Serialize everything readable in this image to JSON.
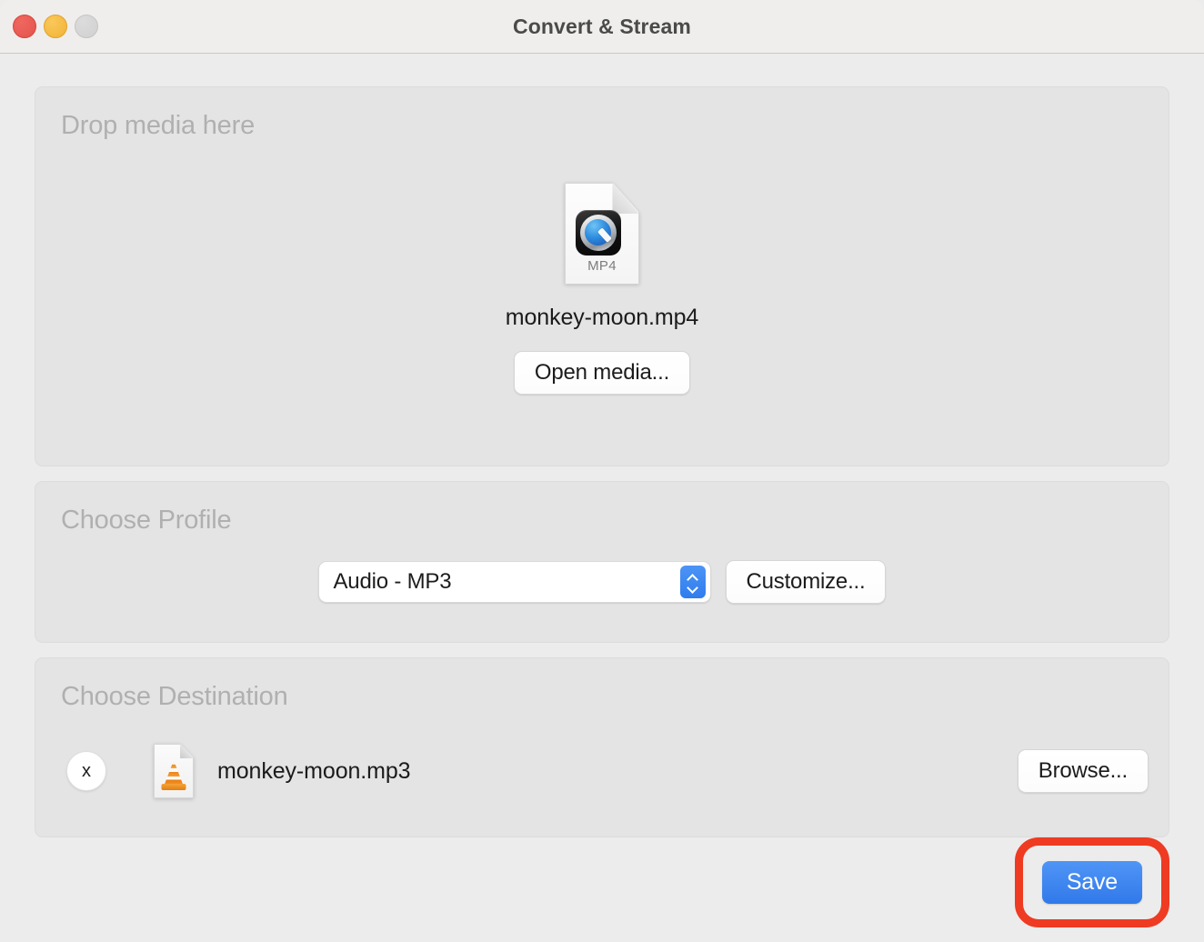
{
  "window": {
    "title": "Convert & Stream",
    "traffic_lights": [
      {
        "name": "close",
        "color": "#e2544c"
      },
      {
        "name": "minimize",
        "color": "#f2b236"
      },
      {
        "name": "zoom",
        "color": "#d4d4d4"
      }
    ]
  },
  "drop_media": {
    "title": "Drop media here",
    "file": {
      "name": "monkey-moon.mp4",
      "icon": "quicktime-mp4-document-icon",
      "extension_label": "MP4"
    },
    "open_media_label": "Open media..."
  },
  "profile": {
    "title": "Choose Profile",
    "selected": "Audio - MP3",
    "options": [
      "Audio - MP3"
    ],
    "stepper_color": "#3179ea",
    "customize_label": "Customize..."
  },
  "destination": {
    "title": "Choose Destination",
    "clear_label": "x",
    "file": {
      "name": "monkey-moon.mp3",
      "icon": "vlc-cone-document-icon"
    },
    "browse_label": "Browse..."
  },
  "footer": {
    "save_label": "Save",
    "save_color": "#3179ea",
    "highlight_color": "#ee3b22"
  }
}
